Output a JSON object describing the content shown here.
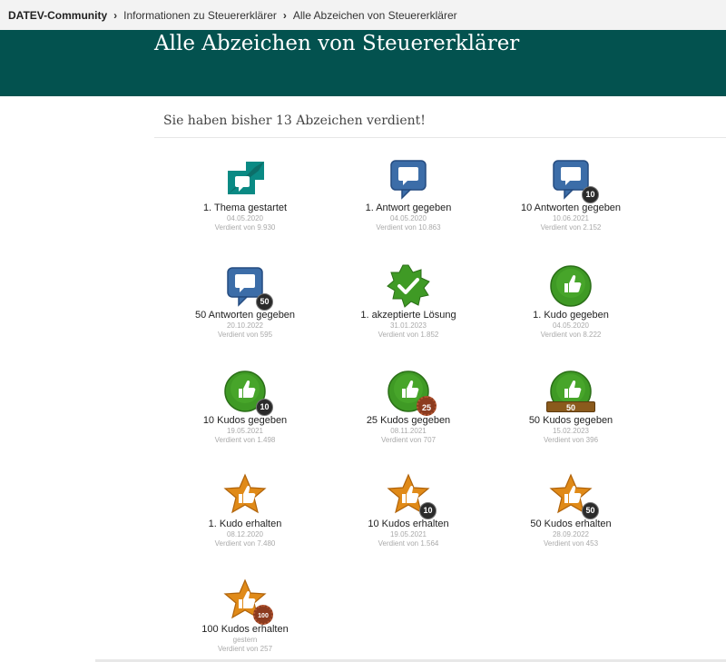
{
  "breadcrumb": {
    "root": "DATEV-Community",
    "parent": "Informationen zu Steuererklärer",
    "current": "Alle Abzeichen von Steuererklärer"
  },
  "page": {
    "title": "Alle Abzeichen von Steuererklärer",
    "summary": "Sie haben bisher 13 Abzeichen verdient!"
  },
  "colors": {
    "banner": "#03524f",
    "teal_icon": "#0a8a84",
    "blue_bubble": "#3c6da8",
    "green_circle": "#3f9a25",
    "orange_star": "#e08a18"
  },
  "badges": [
    {
      "name": "1. Thema gestartet",
      "date": "04.05.2020",
      "earned": "Verdient von 9.930",
      "icon": "topic-arrow-icon"
    },
    {
      "name": "1. Antwort gegeben",
      "date": "04.05.2020",
      "earned": "Verdient von 10.863",
      "icon": "speech-bubble-icon"
    },
    {
      "name": "10 Antworten gegeben",
      "date": "10.06.2021",
      "earned": "Verdient von 2.152",
      "icon": "speech-bubble-10-icon",
      "count": "10"
    },
    {
      "name": "50 Antworten gegeben",
      "date": "20.10.2022",
      "earned": "Verdient von 595",
      "icon": "speech-bubble-50-icon",
      "count": "50"
    },
    {
      "name": "1. akzeptierte Lösung",
      "date": "31.01.2023",
      "earned": "Verdient von 1.852",
      "icon": "checkmark-seal-icon"
    },
    {
      "name": "1. Kudo gegeben",
      "date": "04.05.2020",
      "earned": "Verdient von 8.222",
      "icon": "thumbs-up-icon"
    },
    {
      "name": "10 Kudos gegeben",
      "date": "19.05.2021",
      "earned": "Verdient von 1.498",
      "icon": "thumbs-up-10-icon",
      "count": "10"
    },
    {
      "name": "25 Kudos gegeben",
      "date": "08.11.2021",
      "earned": "Verdient von 707",
      "icon": "thumbs-up-25-icon",
      "count": "25"
    },
    {
      "name": "50 Kudos gegeben",
      "date": "15.02.2023",
      "earned": "Verdient von 396",
      "icon": "thumbs-up-50-icon",
      "count": "50"
    },
    {
      "name": "1. Kudo erhalten",
      "date": "08.12.2020",
      "earned": "Verdient von 7.480",
      "icon": "star-thumbs-up-icon"
    },
    {
      "name": "10 Kudos erhalten",
      "date": "19.05.2021",
      "earned": "Verdient von 1.564",
      "icon": "star-thumbs-up-10-icon",
      "count": "10"
    },
    {
      "name": "50 Kudos erhalten",
      "date": "28.09.2022",
      "earned": "Verdient von 453",
      "icon": "star-thumbs-up-50-icon",
      "count": "50"
    },
    {
      "name": "100 Kudos erhalten",
      "date": "gestern",
      "earned": "Verdient von 257",
      "icon": "star-thumbs-up-100-icon",
      "count": "100"
    }
  ]
}
